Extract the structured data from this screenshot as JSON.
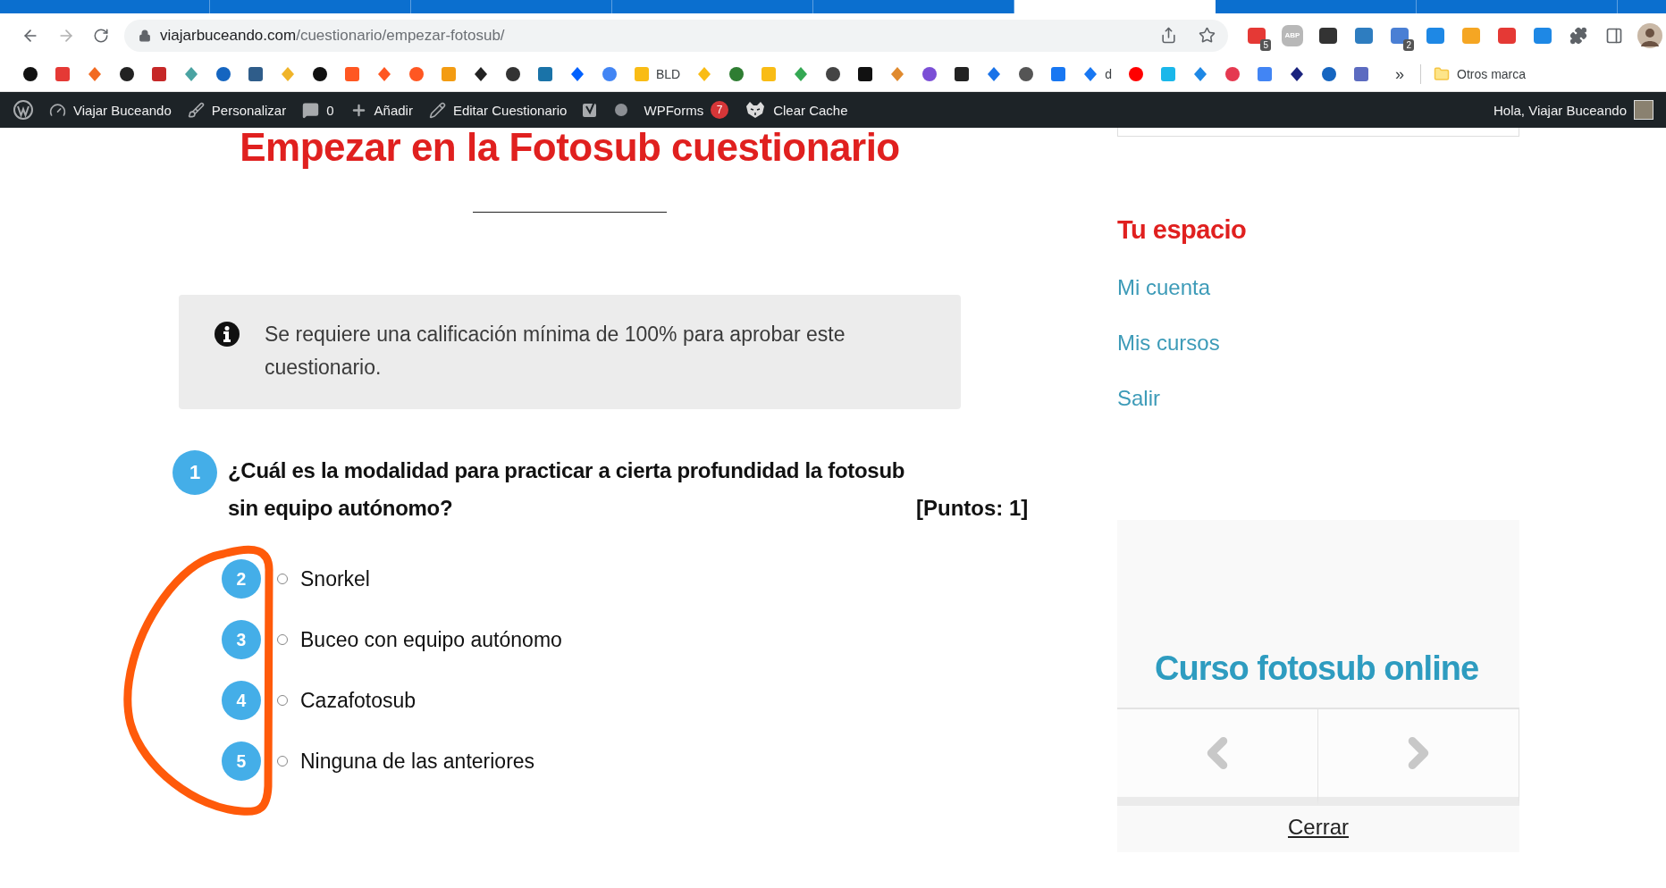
{
  "browser": {
    "tabs": [
      {
        "selected": false
      },
      {
        "selected": false
      },
      {
        "selected": false
      },
      {
        "selected": false
      },
      {
        "selected": false
      },
      {
        "selected": true
      },
      {
        "selected": false
      },
      {
        "selected": false
      }
    ],
    "url_host": "viajarbuceando.com",
    "url_path": "/cuestionario/empezar-fotosub/",
    "extensions": [
      {
        "kind": "ext",
        "badge": "5"
      },
      {
        "kind": "label",
        "label": "ABP"
      },
      {
        "kind": "ext"
      },
      {
        "kind": "ext"
      },
      {
        "kind": "ext",
        "badge": "2"
      },
      {
        "kind": "ext"
      },
      {
        "kind": "ext"
      },
      {
        "kind": "ext"
      },
      {
        "kind": "ext"
      },
      {
        "kind": "puzzle"
      },
      {
        "kind": "panel"
      },
      {
        "kind": "avatar"
      }
    ],
    "bookmarks": [
      {
        "kind": "icon"
      },
      {
        "kind": "icon"
      },
      {
        "kind": "icon"
      },
      {
        "kind": "icon"
      },
      {
        "kind": "icon"
      },
      {
        "kind": "icon"
      },
      {
        "kind": "icon"
      },
      {
        "kind": "icon"
      },
      {
        "kind": "icon"
      },
      {
        "kind": "icon"
      },
      {
        "kind": "icon"
      },
      {
        "kind": "icon"
      },
      {
        "kind": "icon"
      },
      {
        "kind": "icon"
      },
      {
        "kind": "icon"
      },
      {
        "kind": "icon"
      },
      {
        "kind": "icon"
      },
      {
        "kind": "icon"
      },
      {
        "kind": "icon"
      },
      {
        "kind": "labeled",
        "label": "BLD"
      },
      {
        "kind": "icon"
      },
      {
        "kind": "icon"
      },
      {
        "kind": "icon"
      },
      {
        "kind": "icon"
      },
      {
        "kind": "icon"
      },
      {
        "kind": "icon"
      },
      {
        "kind": "icon"
      },
      {
        "kind": "icon"
      },
      {
        "kind": "icon"
      },
      {
        "kind": "icon"
      },
      {
        "kind": "icon"
      },
      {
        "kind": "icon"
      },
      {
        "kind": "labeled",
        "label": "d"
      },
      {
        "kind": "icon"
      },
      {
        "kind": "icon"
      },
      {
        "kind": "icon"
      },
      {
        "kind": "icon"
      },
      {
        "kind": "icon"
      },
      {
        "kind": "icon"
      },
      {
        "kind": "icon"
      },
      {
        "kind": "icon"
      }
    ],
    "bookmarks_more": "»",
    "other_bookmarks": "Otros marca"
  },
  "admin_bar": {
    "items": [
      {
        "kind": "wordpress"
      },
      {
        "kind": "site",
        "label": "Viajar Buceando"
      },
      {
        "kind": "customize",
        "label": "Personalizar"
      },
      {
        "kind": "comments",
        "label": "0"
      },
      {
        "kind": "new",
        "label": "Añadir"
      },
      {
        "kind": "edit",
        "label": "Editar Cuestionario"
      },
      {
        "kind": "yoast"
      },
      {
        "kind": "status"
      },
      {
        "kind": "forms",
        "label": "WPForms",
        "badge": "7"
      },
      {
        "kind": "cache",
        "label": "Clear Cache"
      }
    ],
    "greeting": "Hola, Viajar Buceando"
  },
  "page_title": "Empezar en la Fotosub cuestionario",
  "notice": "Se requiere una calificación mínima de 100% para aprobar este cuestionario.",
  "question": {
    "number": "1",
    "text": "¿Cuál es la modalidad para practicar a cierta profundidad la fotosub sin equipo autónomo?",
    "points": "[Puntos: 1]",
    "options": [
      {
        "number": "2",
        "label": "Snorkel",
        "selected": false
      },
      {
        "number": "3",
        "label": "Buceo con equipo autónomo",
        "selected": false
      },
      {
        "number": "4",
        "label": "Cazafotosub",
        "selected": false
      },
      {
        "number": "5",
        "label": "Ninguna de las anteriores",
        "selected": false
      }
    ]
  },
  "sidebar": {
    "heading": "Tu espacio",
    "links": [
      "Mi cuenta",
      "Mis cursos",
      "Salir"
    ],
    "card": {
      "title": "Curso fotosub online",
      "close": "Cerrar"
    }
  }
}
